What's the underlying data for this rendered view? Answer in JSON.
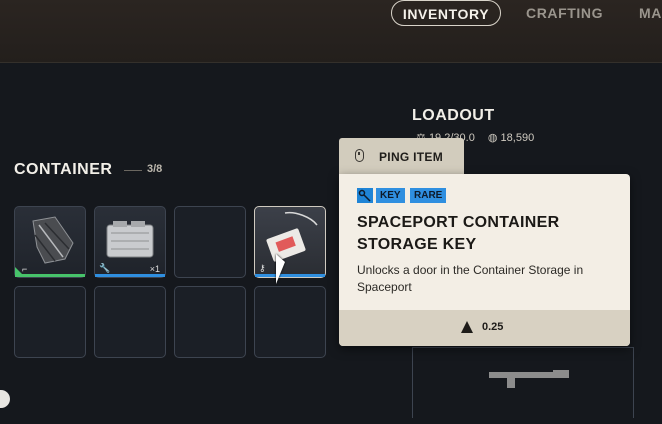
{
  "nav": {
    "tabs": [
      {
        "label": "INVENTORY",
        "active": true
      },
      {
        "label": "CRAFTING",
        "active": false
      },
      {
        "label": "MA",
        "active": false
      }
    ]
  },
  "container": {
    "title": "CONTAINER",
    "count": "3/8",
    "slots": [
      {
        "item": "bracket-pack",
        "rarity_color": "#47c36a",
        "category_icon": "gun-icon",
        "qty": ""
      },
      {
        "item": "toaster",
        "rarity_color": "#2f8fe0",
        "category_icon": "wrench-icon",
        "qty": "×1"
      },
      {
        "item": "",
        "rarity_color": "",
        "category_icon": "",
        "qty": ""
      },
      {
        "item": "container-storage-key",
        "rarity_color": "#2f8fe0",
        "category_icon": "key-icon",
        "qty": ""
      },
      {
        "item": "",
        "rarity_color": "",
        "category_icon": "",
        "qty": ""
      },
      {
        "item": "",
        "rarity_color": "",
        "category_icon": "",
        "qty": ""
      },
      {
        "item": "",
        "rarity_color": "",
        "category_icon": "",
        "qty": ""
      },
      {
        "item": "",
        "rarity_color": "",
        "category_icon": "",
        "qty": ""
      }
    ]
  },
  "loadout": {
    "title": "LOADOUT",
    "weight": "19.2/30.0",
    "credits": "18,590"
  },
  "ping": {
    "label": "PING ITEM",
    "icon": "mouse-icon"
  },
  "tooltip": {
    "tags": [
      "KEY",
      "RARE"
    ],
    "tag_color": "#2f8fe0",
    "title": "SPACEPORT CONTAINER STORAGE KEY",
    "description": "Unlocks a door in the Container Storage in Spaceport",
    "weight": "0.25"
  }
}
